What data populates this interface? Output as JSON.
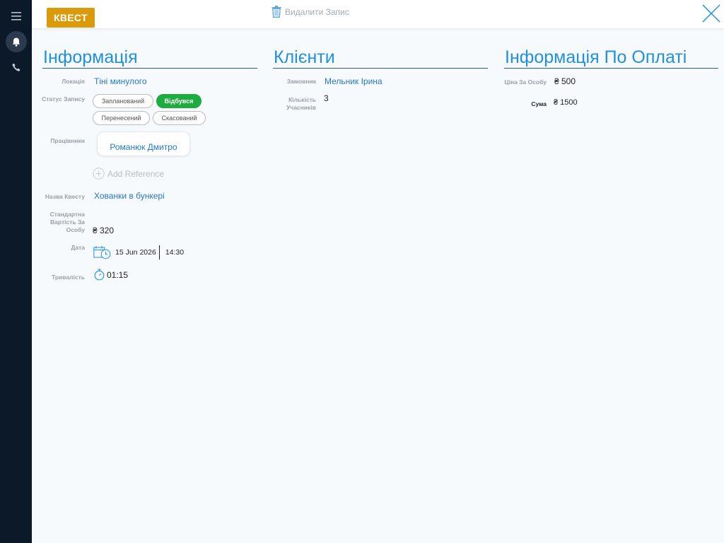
{
  "header": {
    "badge": "КВЕСТ",
    "delete_label": "Видалити Запис"
  },
  "info": {
    "title": "Інформація",
    "location_label": "Локація",
    "location_value": "Тіні минулого",
    "status_label": "Статус Запису",
    "statuses": [
      "Запланований",
      "Відбувся",
      "Перенесений",
      "Скасований"
    ],
    "active_status": "Відбувся",
    "workers_label": "Працівники",
    "worker": "Романюк Дмитро",
    "add_reference": "Add Reference",
    "quest_name_label": "Назва Квесту",
    "quest_name_value": "Хованки в бункері",
    "std_cost_label": "Стандартна Вартість За Особу",
    "std_cost_value": "₴ 320",
    "date_label": "Дата",
    "date_value": "15 Jun 2026",
    "time_value": "14:30",
    "duration_label": "Тривалість",
    "duration_value": "01:15"
  },
  "clients": {
    "title": "Клієнти",
    "customer_label": "Замовник",
    "customer_value": "Мельник Ірина",
    "participants_label": "Кількість Учасників",
    "participants_value": "3"
  },
  "payment": {
    "title": "Інформація По Оплаті",
    "price_label": "Ціна За Особу",
    "price_value": "₴ 500",
    "sum_label": "Сума",
    "sum_value": "₴ 1500"
  },
  "colors": {
    "accent": "#2190e2",
    "badge": "#d99b0c",
    "active": "#1dac3f",
    "rail": "#0c1929"
  }
}
